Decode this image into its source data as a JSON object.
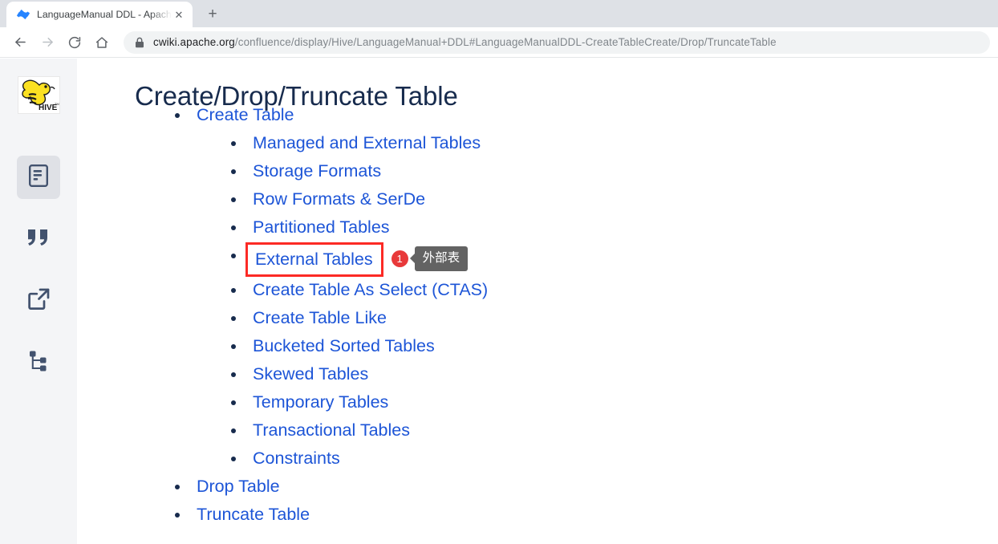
{
  "browser": {
    "tab": {
      "favicon": "confluence-logo-icon",
      "title": "LanguageManual DDL - Apache Hive - Apache Software Foundation",
      "close_label": "✕"
    },
    "new_tab_label": "+",
    "nav": {
      "back": "back-arrow-icon",
      "forward": "forward-arrow-icon",
      "reload": "reload-icon",
      "home": "home-icon"
    },
    "omnibox": {
      "lock": "lock-icon",
      "host": "cwiki.apache.org",
      "path": "/confluence/display/Hive/LanguageManual+DDL#LanguageManualDDL-CreateTableCreate/Drop/TruncateTable"
    }
  },
  "sidebar": {
    "logo": "apache-hive-logo",
    "items": [
      {
        "icon": "document-page-icon",
        "name": "pages",
        "active": true
      },
      {
        "icon": "quote-marks-icon",
        "name": "blog",
        "active": false
      },
      {
        "icon": "external-link-icon",
        "name": "shortcut-links",
        "active": false
      },
      {
        "icon": "sitemap-tree-icon",
        "name": "page-tree",
        "active": false
      }
    ],
    "resize_handle": "sidebar-resize-handle"
  },
  "content": {
    "title": "Create/Drop/Truncate Table",
    "toc": [
      {
        "label": "Create Table",
        "children": [
          {
            "label": "Managed and External Tables"
          },
          {
            "label": "Storage Formats"
          },
          {
            "label": "Row Formats & SerDe"
          },
          {
            "label": "Partitioned Tables"
          },
          {
            "label": "External Tables",
            "highlighted": true
          },
          {
            "label": "Create Table As Select (CTAS)"
          },
          {
            "label": "Create Table Like"
          },
          {
            "label": "Bucketed Sorted Tables"
          },
          {
            "label": "Skewed Tables"
          },
          {
            "label": "Temporary Tables"
          },
          {
            "label": "Transactional Tables"
          },
          {
            "label": "Constraints"
          }
        ]
      },
      {
        "label": "Drop Table",
        "children": []
      },
      {
        "label": "Truncate Table",
        "children": []
      }
    ]
  },
  "annotation": {
    "badge": "1",
    "tooltip": "外部表",
    "highlight_color": "#fc2a25",
    "badge_color": "#e8393a",
    "tooltip_bg": "#636363"
  },
  "colors": {
    "link": "#1d55d7",
    "heading": "#172b4d",
    "sidebar_bg": "#f4f5f7",
    "tabstrip_bg": "#dee1e6",
    "omnibox_bg": "#f1f3f4"
  }
}
